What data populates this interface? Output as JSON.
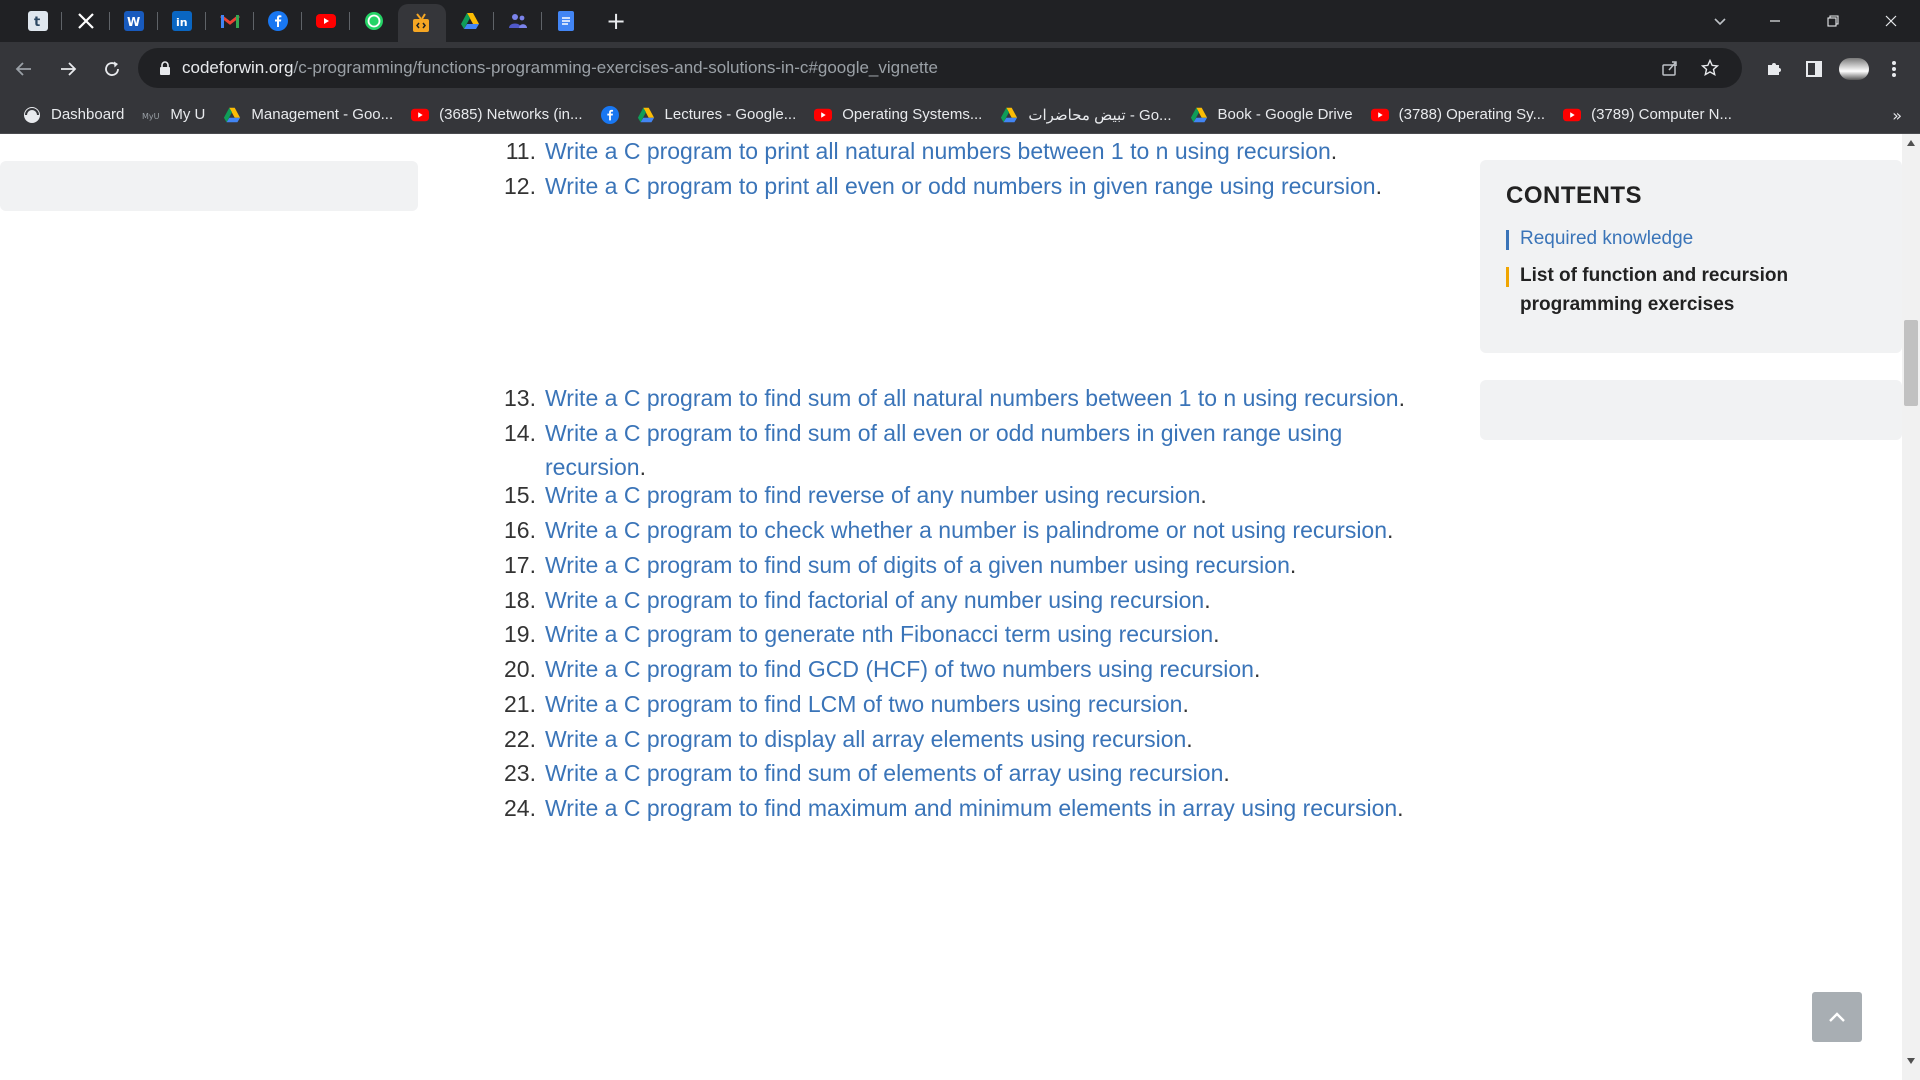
{
  "tabs": [
    {
      "icon": "tumblr-icon",
      "letter": "t",
      "color": "#2c4762",
      "active": false
    },
    {
      "icon": "x-icon",
      "letter": "X",
      "color": "#000000",
      "active": false
    },
    {
      "icon": "word-icon",
      "letter": "W",
      "color": "#185abd",
      "active": false
    },
    {
      "icon": "linkedin-icon",
      "letter": "in",
      "color": "#0a66c2",
      "active": false
    },
    {
      "icon": "gmail-icon",
      "letter": "M",
      "color": "#202124",
      "active": false
    },
    {
      "icon": "facebook-icon",
      "letter": "f",
      "color": "#1877f2",
      "active": false
    },
    {
      "icon": "youtube-icon",
      "letter": "▶",
      "color": "#ff0000",
      "active": false
    },
    {
      "icon": "whatsapp-icon",
      "letter": "✆",
      "color": "#25d366",
      "active": false
    },
    {
      "icon": "codeforwin-icon",
      "letter": "</>",
      "color": "#f5a623",
      "active": true
    },
    {
      "icon": "google-drive-icon",
      "letter": "▲",
      "color": "#202124",
      "active": false
    },
    {
      "icon": "teams-icon",
      "letter": "👥",
      "color": "#202124",
      "active": false
    },
    {
      "icon": "google-docs-icon",
      "letter": "≡",
      "color": "#4285f4",
      "active": false
    }
  ],
  "address": {
    "host": "codeforwin.org",
    "path": "/c-programming/functions-programming-exercises-and-solutions-in-c#google_vignette"
  },
  "bookmarks": [
    {
      "label": "Dashboard",
      "icon": "dashboard-icon"
    },
    {
      "label": "My U",
      "icon": "myu-icon"
    },
    {
      "label": "Management - Goo...",
      "icon": "google-drive-icon"
    },
    {
      "label": "(3685) Networks (in...",
      "icon": "youtube-icon"
    },
    {
      "label": "",
      "icon": "facebook-icon"
    },
    {
      "label": "Lectures - Google...",
      "icon": "google-drive-icon"
    },
    {
      "label": "Operating Systems...",
      "icon": "youtube-icon"
    },
    {
      "label": "تبيض محاضرات - Go...",
      "icon": "google-drive-icon"
    },
    {
      "label": "Book - Google Drive",
      "icon": "google-drive-icon"
    },
    {
      "label": "(3788) Operating Sy...",
      "icon": "youtube-icon"
    },
    {
      "label": "(3789) Computer N...",
      "icon": "youtube-icon"
    }
  ],
  "bookmarks_overflow": "»",
  "exercises": [
    {
      "num": "11.",
      "text": "Write a C program to print all natural numbers between 1 to n using recursion"
    },
    {
      "num": "12.",
      "text": "Write a C program to print all even or odd numbers in given range using recursion"
    },
    {
      "num": "13.",
      "text": "Write a C program to find sum of all natural numbers between 1 to n using recursion"
    },
    {
      "num": "14.",
      "text": "Write a C program to find sum of all even or odd numbers in given range using recursion"
    },
    {
      "num": "15.",
      "text": "Write a C program to find reverse of any number using recursion"
    },
    {
      "num": "16.",
      "text": "Write a C program to check whether a number is palindrome or not using recursion"
    },
    {
      "num": "17.",
      "text": "Write a C program to find sum of digits of a given number using recursion"
    },
    {
      "num": "18.",
      "text": "Write a C program to find factorial of any number using recursion"
    },
    {
      "num": "19.",
      "text": "Write a C program to generate nth Fibonacci term using recursion"
    },
    {
      "num": "20.",
      "text": "Write a C program to find GCD (HCF) of two numbers using recursion"
    },
    {
      "num": "21.",
      "text": "Write a C program to find LCM of two numbers using recursion"
    },
    {
      "num": "22.",
      "text": "Write a C program to display all array elements using recursion"
    },
    {
      "num": "23.",
      "text": "Write a C program to find sum of elements of array using recursion"
    },
    {
      "num": "24.",
      "text": "Write a C program to find maximum and minimum elements in array using recursion"
    }
  ],
  "contents": {
    "title": "CONTENTS",
    "items": [
      {
        "label": "Required knowledge",
        "active": false
      },
      {
        "label": "List of function and recursion programming exercises",
        "active": true
      }
    ]
  },
  "colors": {
    "link": "#3a74b8",
    "toc_active_bar": "#f0a500",
    "chrome_dark": "#202124",
    "chrome_toolbar": "#35363a"
  }
}
